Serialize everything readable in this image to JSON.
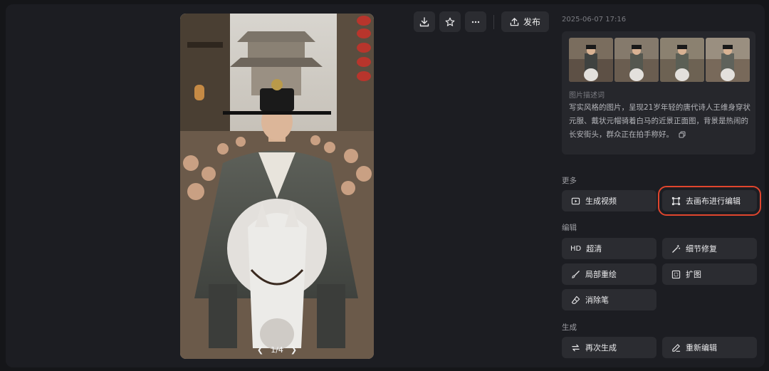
{
  "toolbar": {
    "download_icon": "download-icon",
    "favorite_icon": "star-icon",
    "more_icon": "more-icon",
    "publish_label": "发布"
  },
  "viewer": {
    "page_indicator": "1/4"
  },
  "info": {
    "timestamp": "2025-06-07 17:16",
    "thumbnails_count": 4,
    "description_label": "图片描述词",
    "description": "写实风格的图片，呈现21岁年轻的唐代诗人王维身穿状元服、戴状元帽骑着白马的近景正面图，背景是热闹的长安街头，群众正在拍手称好。"
  },
  "more": {
    "title": "更多",
    "generate_video": "生成视频",
    "canvas_edit": "去画布进行编辑"
  },
  "edit": {
    "title": "编辑",
    "hd_badge": "HD",
    "upscale": "超清",
    "detail_fix": "细节修复",
    "inpaint": "局部重绘",
    "outpaint": "扩图",
    "eraser": "消除笔"
  },
  "generate": {
    "title": "生成",
    "regenerate": "再次生成",
    "re_edit": "重新编辑"
  },
  "colors": {
    "highlight": "#e0452d",
    "button_bg": "#2b2c31",
    "panel_bg": "#1c1d22"
  }
}
